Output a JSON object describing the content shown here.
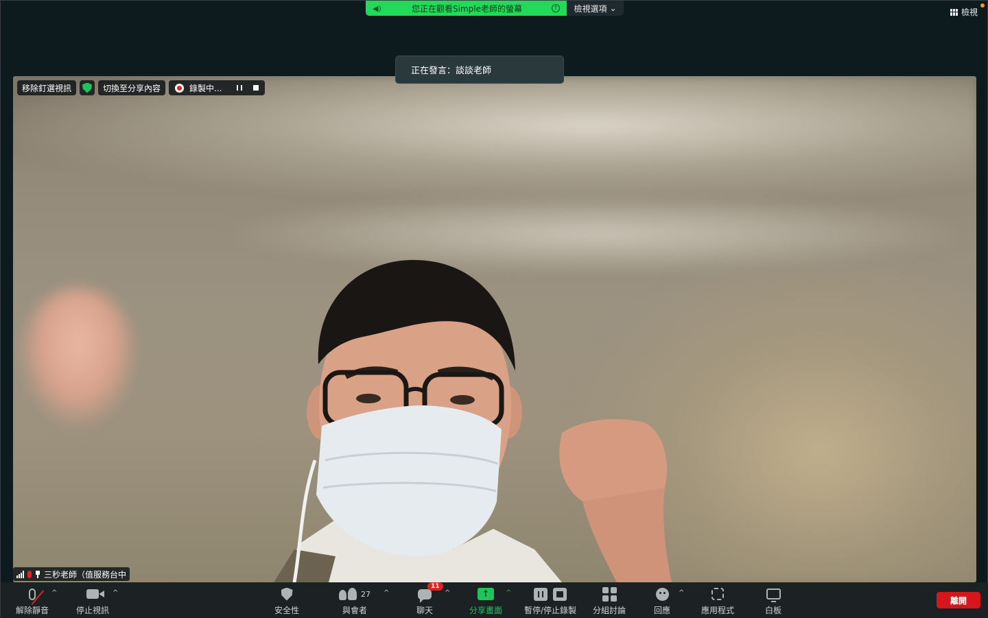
{
  "share_banner": {
    "text": "您正在觀看Simple老師的螢幕",
    "options_label": "檢視選項",
    "options_caret": "⌄"
  },
  "view_button": {
    "label": "檢視"
  },
  "speaking_indicator": {
    "text": "正在發言：談談老師"
  },
  "video_overlay": {
    "remove_pin_label": "移除釘選視訊",
    "switch_to_share_label": "切換至分享內容",
    "recording_label": "錄製中..."
  },
  "participant_tag": {
    "name": "三秒老師（值服務台中"
  },
  "toolbar": {
    "unmute_label": "解除靜音",
    "stop_video_label": "停止視訊",
    "security_label": "安全性",
    "participants_label": "與會者",
    "participants_count": "27",
    "chat_label": "聊天",
    "chat_badge": "11",
    "share_screen_label": "分享畫面",
    "record_label": "暫停/停止錄製",
    "breakout_label": "分組討論",
    "reactions_label": "回應",
    "apps_label": "應用程式",
    "whiteboard_label": "白板",
    "leave_label": "離開",
    "caret": "^"
  },
  "colors": {
    "share_green": "#23d959",
    "leave_red": "#d5171b",
    "toolbar_bg": "#1c2224",
    "window_bg": "#0d1a1e"
  }
}
